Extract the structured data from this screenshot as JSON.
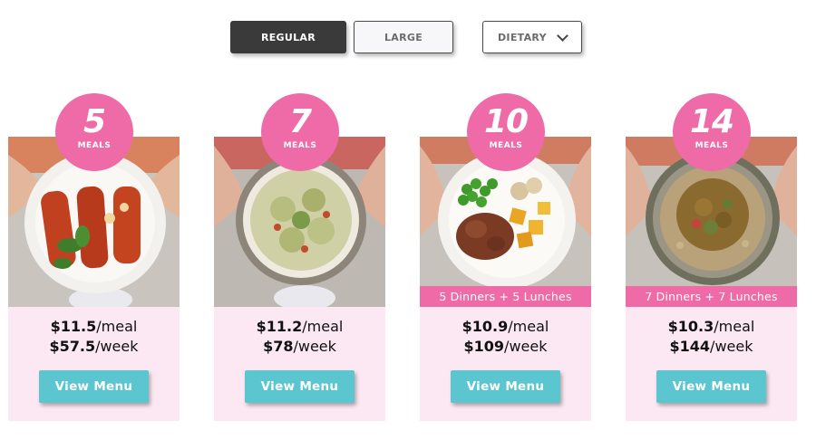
{
  "toggles": {
    "regular": "REGULAR",
    "large": "LARGE",
    "dietary": "DIETARY"
  },
  "plans": [
    {
      "count": "5",
      "unit": "MEALS",
      "per_meal": "$11.5",
      "per_meal_suffix": "/meal",
      "per_week": "$57.5",
      "per_week_suffix": "/week",
      "cta": "View Menu",
      "photo": "manicotti-plate"
    },
    {
      "count": "7",
      "unit": "MEALS",
      "per_meal": "$11.2",
      "per_meal_suffix": "/meal",
      "per_week": "$78",
      "per_week_suffix": "/week",
      "cta": "View Menu",
      "photo": "pesto-pasta-bowl"
    },
    {
      "count": "10",
      "unit": "MEALS",
      "banner": "5 Dinners + 5 Lunches",
      "per_meal": "$10.9",
      "per_meal_suffix": "/meal",
      "per_week": "$109",
      "per_week_suffix": "/week",
      "cta": "View Menu",
      "photo": "beef-peas-potatoes-plate"
    },
    {
      "count": "14",
      "unit": "MEALS",
      "banner": "7 Dinners + 7 Lunches",
      "per_meal": "$10.3",
      "per_meal_suffix": "/meal",
      "per_week": "$144",
      "per_week_suffix": "/week",
      "cta": "View Menu",
      "photo": "curry-rice-bowl"
    }
  ],
  "colors": {
    "accent_pink": "#ee6ba7",
    "card_bg": "#fce8f2",
    "button_teal": "#5bc5d0",
    "toggle_active": "#3a3a3a"
  }
}
